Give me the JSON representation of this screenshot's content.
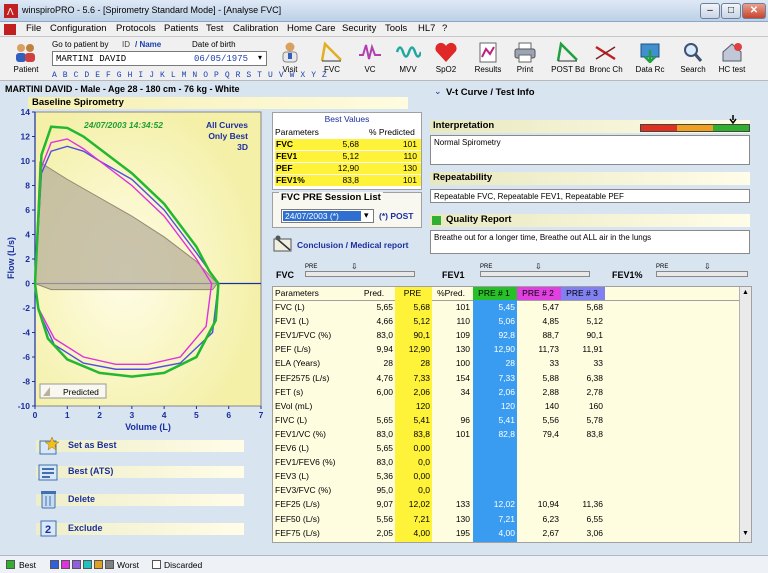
{
  "window": {
    "title": "winspiroPRO  -  5.6  -  [Spirometry Standard Mode]  -  [Analyse FVC]"
  },
  "menu": [
    "File",
    "Configuration",
    "Protocols",
    "Patients",
    "Test",
    "Calibration",
    "Home Care",
    "Security",
    "Tools",
    "HL7",
    "?"
  ],
  "goto": {
    "label": "Go to patient by",
    "id_label": "ID",
    "name_label": "/ Name",
    "dob_label": "Date of birth",
    "name_value": "MARTINI DAVID",
    "dob_value": "06/05/1975",
    "alphabet": "A B C D E F G H I J K L M N O P Q R S T U V W X Y Z"
  },
  "toolbar": {
    "patient": "Patient",
    "visit": "Visit",
    "fvc": "FVC",
    "vc": "VC",
    "mvv": "MVV",
    "spo2": "SpO2",
    "results": "Results",
    "print": "Print",
    "post_bd": "POST Bd",
    "bronc_ch": "Bronc Ch",
    "data_rc": "Data Rc",
    "search": "Search",
    "hc_test": "HC test"
  },
  "patient_line": "MARTINI DAVID - Male - Age 28 - 180 cm - 76 kg - White",
  "baseline_title": "Baseline Spirometry",
  "chart": {
    "timestamp": "24/07/2003 14:34:52",
    "all_curves": "All Curves",
    "only_best": "Only Best",
    "three_d": "3D",
    "ylabel": "Flow (L/s)",
    "xlabel": "Volume (L)",
    "predicted_label": "Predicted",
    "y_ticks": [
      "14",
      "12",
      "10",
      "8",
      "6",
      "4",
      "2",
      "0",
      "-2",
      "-4",
      "-6",
      "-8",
      "-10"
    ],
    "x_ticks": [
      "0",
      "1",
      "2",
      "3",
      "4",
      "5",
      "6",
      "7"
    ],
    "colors": {
      "best": "#22b830",
      "magenta": "#e030e0",
      "blue": "#5050e0"
    }
  },
  "chart_data": {
    "type": "line",
    "xlabel": "Volume (L)",
    "ylabel": "Flow (L/s)",
    "xlim": [
      0,
      7
    ],
    "ylim": [
      -10,
      14
    ],
    "series": [
      {
        "x": [
          0,
          0.2,
          0.5,
          1.0,
          1.5,
          2.0,
          3.0,
          4.0,
          5.0,
          5.4,
          5.68,
          5.6,
          5.0,
          4.0,
          3.0,
          2.0,
          1.0,
          0.4,
          0.1,
          0
        ],
        "y": [
          0,
          10.5,
          12.8,
          12.7,
          12.0,
          11.0,
          9.0,
          6.5,
          3.0,
          1.0,
          0,
          -3.0,
          -6.0,
          -7.3,
          -7.6,
          -7.3,
          -6.2,
          -4.5,
          -2.0,
          0
        ]
      },
      {
        "x": [
          0,
          0.2,
          0.5,
          1.0,
          1.5,
          2.0,
          3.0,
          4.0,
          5.0,
          5.47,
          5.3,
          4.5,
          3.5,
          2.5,
          1.5,
          0.6,
          0.1,
          0
        ],
        "y": [
          0,
          9.5,
          11.5,
          11.8,
          11.0,
          10.0,
          8.0,
          5.5,
          2.0,
          0,
          -3.5,
          -6.0,
          -6.6,
          -6.6,
          -6.0,
          -4.5,
          -2.0,
          0
        ]
      },
      {
        "x": [
          0,
          0.2,
          0.5,
          1.0,
          1.5,
          2.0,
          3.0,
          4.0,
          5.0,
          5.68,
          5.5,
          4.5,
          3.5,
          2.5,
          1.5,
          0.6,
          0.1,
          0
        ],
        "y": [
          0,
          9.0,
          10.8,
          11.2,
          10.8,
          10.0,
          8.5,
          6.0,
          2.5,
          0,
          -4.0,
          -6.5,
          -7.0,
          -7.0,
          -6.5,
          -5.0,
          -2.2,
          0
        ]
      },
      {
        "x": [
          0,
          0.15,
          1.0,
          2.0,
          3.0,
          4.0,
          5.0,
          5.65,
          5.5,
          4.5,
          3.5,
          2.5,
          1.5,
          0.5,
          0
        ],
        "y": [
          0,
          9.9,
          8.5,
          7.0,
          5.5,
          3.8,
          1.8,
          0,
          -0.5,
          -0.5,
          -0.5,
          -0.5,
          -0.5,
          -0.5,
          0
        ]
      }
    ]
  },
  "best_values": {
    "title": "Best Values",
    "col_params": "Parameters",
    "col_pct": "% Predicted",
    "rows": [
      {
        "name": "FVC",
        "value": "5,68",
        "pct": "101"
      },
      {
        "name": "FEV1",
        "value": "5,12",
        "pct": "110"
      },
      {
        "name": "PEF",
        "value": "12,90",
        "pct": "130"
      },
      {
        "name": "FEV1%",
        "value": "83,8",
        "pct": "101"
      }
    ]
  },
  "session": {
    "title": "FVC PRE Session List",
    "selected": "24/07/2003 (*)",
    "post": "(*) POST",
    "conclusion": "Conclusion / Medical report"
  },
  "right": {
    "vt_title": "V-t Curve / Test Info",
    "interpretation_title": "Interpretation",
    "interpretation_text": "Normal Spirometry",
    "repeatability_title": "Repeatability",
    "repeatability_text": "Repeatable FVC, Repeatable FEV1, Repeatable PEF",
    "quality_title": "Quality Report",
    "quality_text": "Breathe out for a longer time, Breathe out ALL air in the lungs"
  },
  "gauges": {
    "fvc": "FVC",
    "fev1": "FEV1",
    "fev1pct": "FEV1%",
    "pre": "PRE"
  },
  "table": {
    "headers": [
      "Parameters",
      "Pred.",
      "PRE",
      "%Pred.",
      "PRE # 1",
      "PRE # 2",
      "PRE # 3"
    ],
    "rows": [
      [
        "FVC (L)",
        "5,65",
        "5,68",
        "101",
        "5,45",
        "5,47",
        "5,68"
      ],
      [
        "FEV1 (L)",
        "4,66",
        "5,12",
        "110",
        "5,06",
        "4,85",
        "5,12"
      ],
      [
        "FEV1/FVC (%)",
        "83,0",
        "90,1",
        "109",
        "92,8",
        "88,7",
        "90,1"
      ],
      [
        "PEF (L/s)",
        "9,94",
        "12,90",
        "130",
        "12,90",
        "11,73",
        "11,91"
      ],
      [
        "ELA (Years)",
        "28",
        "28",
        "100",
        "28",
        "33",
        "33"
      ],
      [
        "FEF2575 (L/s)",
        "4,76",
        "7,33",
        "154",
        "7,33",
        "5,88",
        "6,38"
      ],
      [
        "FET (s)",
        "6,00",
        "2,06",
        "34",
        "2,06",
        "2,88",
        "2,78"
      ],
      [
        "EVol (mL)",
        "",
        "120",
        "",
        "120",
        "140",
        "160"
      ],
      [
        "FIVC (L)",
        "5,65",
        "5,41",
        "96",
        "5,41",
        "5,56",
        "5,78"
      ],
      [
        "FEV1/VC (%)",
        "83,0",
        "83,8",
        "101",
        "82,8",
        "79,4",
        "83,8"
      ],
      [
        "FEV6 (L)",
        "5,65",
        "0,00",
        "",
        "",
        "",
        ""
      ],
      [
        "FEV1/FEV6 (%)",
        "83,0",
        "0,0",
        "",
        "",
        "",
        ""
      ],
      [
        "FEV3 (L)",
        "5,36",
        "0,00",
        "",
        "",
        "",
        ""
      ],
      [
        "FEV3/FVC (%)",
        "95,0",
        "0,0",
        "",
        "",
        "",
        ""
      ],
      [
        "FEF25 (L/s)",
        "9,07",
        "12,02",
        "133",
        "12,02",
        "10,94",
        "11,36"
      ],
      [
        "FEF50 (L/s)",
        "5,56",
        "7,21",
        "130",
        "7,21",
        "6,23",
        "6,55"
      ],
      [
        "FEF75 (L/s)",
        "2,05",
        "4,00",
        "195",
        "4,00",
        "2,67",
        "3,06"
      ]
    ]
  },
  "actions": {
    "set_best": "Set as Best",
    "best_ats": "Best (ATS)",
    "delete": "Delete",
    "exclude": "Exclude"
  },
  "status": {
    "best": "Best",
    "worst": "Worst",
    "discarded": "Discarded"
  }
}
